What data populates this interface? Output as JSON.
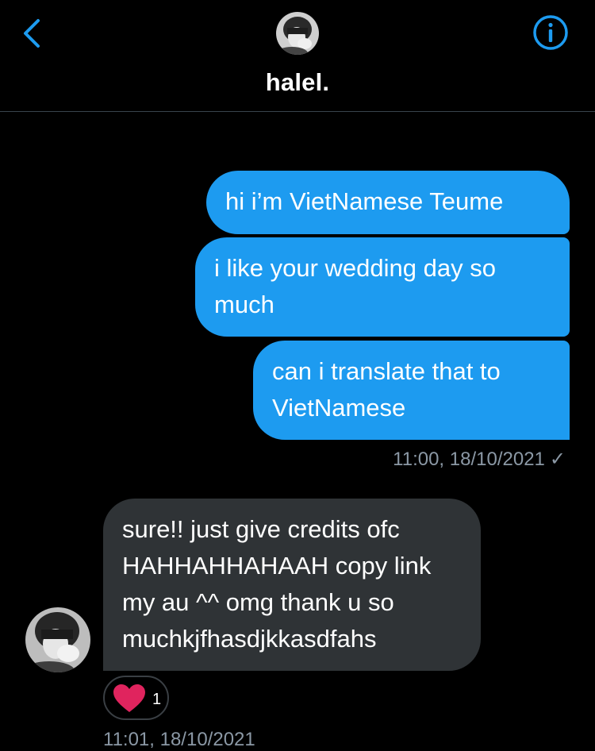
{
  "header": {
    "name": "halel.",
    "accent_color": "#1d9bf0"
  },
  "messages": [
    {
      "direction": "sent",
      "text": "hi i’m VietNamese Teume"
    },
    {
      "direction": "sent",
      "text": "i like your wedding day so much"
    },
    {
      "direction": "sent",
      "text": "can i translate that to VietNamese"
    },
    {
      "direction": "received",
      "text": "sure!! just give credits ofc HAHHAHHAHAAH copy link my au ^^ omg thank u so muchkjfhasdjkkasdfahs"
    }
  ],
  "sent_timestamp": "11:00, 18/10/2021",
  "sent_status_icon": "check-icon",
  "reaction": {
    "emoji_icon": "heart-icon",
    "count": "1",
    "color": "#e0245e"
  },
  "received_timestamp": "11:01, 18/10/2021",
  "colors": {
    "sent_bubble": "#1d9bf0",
    "received_bubble": "#2f3336",
    "timestamp": "#8b98a5",
    "background": "#000000"
  }
}
